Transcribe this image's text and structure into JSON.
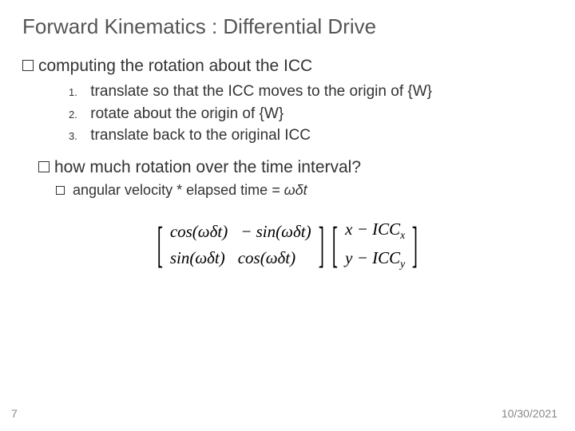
{
  "title": "Forward Kinematics : Differential Drive",
  "bullet1": "computing the rotation about the ICC",
  "steps": {
    "n1": "1.",
    "t1": "translate so that the ICC moves to the origin of {W}",
    "n2": "2.",
    "t2": "rotate about the origin of {W}",
    "n3": "3.",
    "t3": "translate back to the original ICC"
  },
  "bullet2": "how much rotation over the time interval?",
  "sub_text": "angular velocity * elapsed time",
  "eq_tail": " = ωδt",
  "matrixA": {
    "r1c1": "cos(ωδt)",
    "r1c2": "− sin(ωδt)",
    "r2c1": "sin(ωδt)",
    "r2c2": "cos(ωδt)"
  },
  "matrixB": {
    "r1_pre": "x − ICC",
    "r1_sub": "x",
    "r2_pre": "y − ICC",
    "r2_sub": "y"
  },
  "footer": {
    "page": "7",
    "date": "10/30/2021"
  }
}
